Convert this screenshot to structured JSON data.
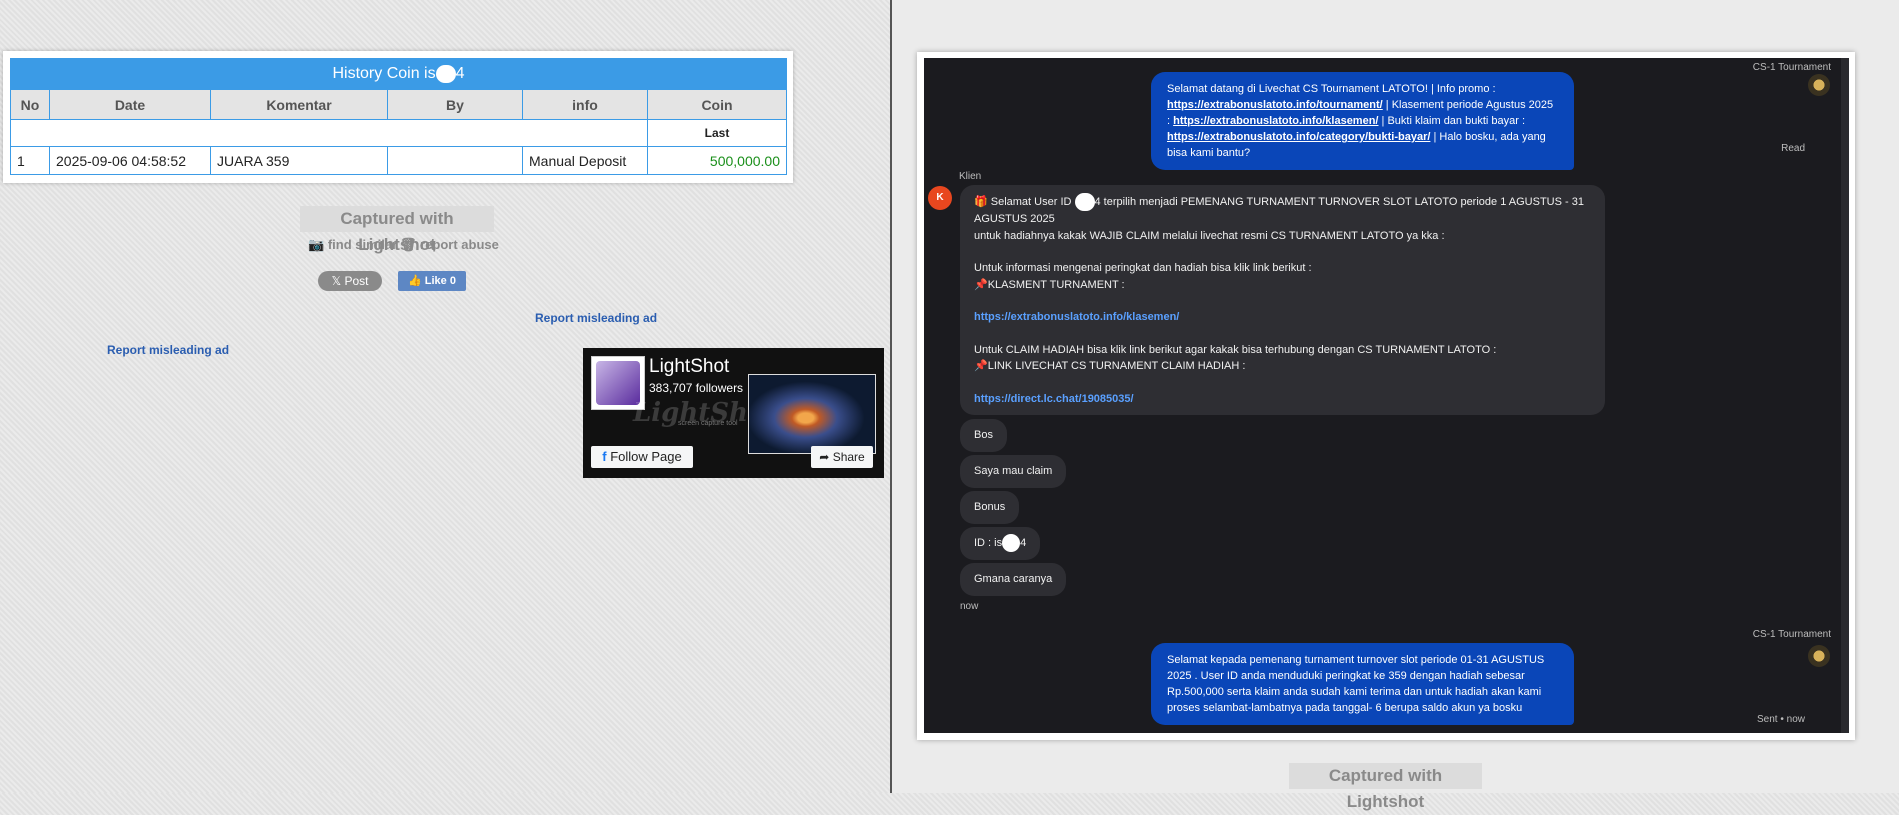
{
  "coin_table": {
    "title": "History Coin is",
    "title_suffix": "4",
    "headers": [
      "No",
      "Date",
      "Komentar",
      "By",
      "info",
      "Coin"
    ],
    "sub_header": "Last",
    "rows": [
      {
        "no": "1",
        "date": "2025-09-06 04:58:52",
        "komentar": "JUARA 359",
        "by": "",
        "info": "Manual Deposit",
        "coin": "500,000.00"
      }
    ]
  },
  "left_footer": {
    "captured": "Captured with Lightshot",
    "find_similar": "find similar",
    "report_abuse": "report abuse",
    "post_label": "Post",
    "like_label": "Like 0",
    "report_ad_1": "Report misleading ad",
    "report_ad_2": "Report misleading ad"
  },
  "fb_widget": {
    "name": "LightShot",
    "followers": "383,707 followers",
    "wordmark": "LightShot",
    "tagline": "screen capture tool",
    "follow_label": "Follow Page",
    "share_label": "Share"
  },
  "chat": {
    "agent_name_1": "CS-1 Tournament",
    "msg1": {
      "p1": "Selamat datang di Livechat CS Tournament LATOTO! | Info promo : ",
      "link1": "https://extrabonuslatoto.info/tournament/",
      "p2": " | Klasement periode Agustus 2025 : ",
      "link2": "https://extrabonuslatoto.info/klasemen/",
      "p3": " | Bukti klaim dan bukti bayar : ",
      "link3": "https://extrabonuslatoto.info/category/bukti-bayar/",
      "p4": " | Halo bosku, ada yang bisa kami bantu?"
    },
    "read_label": "Read",
    "client_label": "Klien",
    "client_initial": "K",
    "msg2": {
      "line1a": "🎁 Selamat User ID ",
      "line1b": "4 terpilih menjadi PEMENANG TURNAMENT TURNOVER SLOT LATOTO periode 1 AGUSTUS - 31 AGUSTUS 2025",
      "line2": "untuk hadiahnya kakak WAJIB CLAIM melalui livechat resmi CS TURNAMENT LATOTO ya kka :",
      "line3": "Untuk informasi mengenai peringkat dan hadiah bisa klik link berikut :",
      "line4": "📌KLASMENT TURNAMENT :",
      "link1": "https://extrabonuslatoto.info/klasemen/",
      "line5": "Untuk CLAIM HADIAH bisa klik link berikut agar kakak bisa terhubung dengan CS TURNAMENT LATOTO :",
      "line6": "📌LINK LIVECHAT CS TURNAMENT CLAIM HADIAH :",
      "link2": "https://direct.lc.chat/19085035/"
    },
    "short_msgs": [
      "Bos",
      "Saya mau claim",
      "Bonus",
      "ID : is",
      "Gmana caranya"
    ],
    "id_suffix": "4",
    "now_label": "now",
    "agent_name_2": "CS-1 Tournament",
    "msg3": "Selamat kepada pemenang turnament turnover slot periode 01-31 AGUSTUS 2025 . User ID anda menduduki peringkat ke 359 dengan hadiah sebesar Rp.500,000 serta klaim anda sudah kami terima dan untuk hadiah akan kami proses selambat-lambatnya pada tanggal- 6 berupa saldo akun ya bosku",
    "sent_label": "Sent • now"
  },
  "right_footer": {
    "captured": "Captured with Lightshot"
  },
  "colors": {
    "table_blue": "#3b9be6",
    "coin_green": "#1a8f1a",
    "agent_bubble": "#0a46b8",
    "chat_bg": "#1b1b1f"
  }
}
